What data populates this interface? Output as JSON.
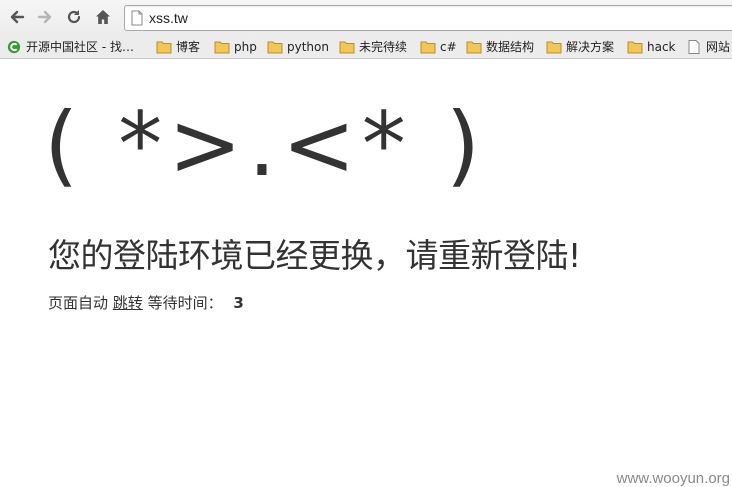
{
  "browser": {
    "url": "xss.tw",
    "bookmarks": [
      {
        "label": "开源中国社区 - 找…",
        "icon": "site-favicon-icon"
      },
      {
        "label": "博客",
        "icon": "folder-icon"
      },
      {
        "label": "php",
        "icon": "folder-icon"
      },
      {
        "label": "python",
        "icon": "folder-icon"
      },
      {
        "label": "未完待续",
        "icon": "folder-icon"
      },
      {
        "label": "c#",
        "icon": "folder-icon"
      },
      {
        "label": "数据结构",
        "icon": "folder-icon"
      },
      {
        "label": "解决方案",
        "icon": "folder-icon"
      },
      {
        "label": "hack",
        "icon": "folder-icon"
      },
      {
        "label": "网站",
        "icon": "page-icon"
      }
    ]
  },
  "page": {
    "emoticon": "( *>.<* )",
    "message": "您的登陆环境已经更换，请重新登陆!",
    "redirect_prefix": "页面自动",
    "redirect_link": "跳转",
    "wait_label": "等待时间：",
    "countdown": "3"
  },
  "watermark": "www.wooyun.org",
  "colors": {
    "text": "#333333",
    "favicon_green": "#3a9a3a",
    "folder_yellow": "#f1c75a"
  }
}
